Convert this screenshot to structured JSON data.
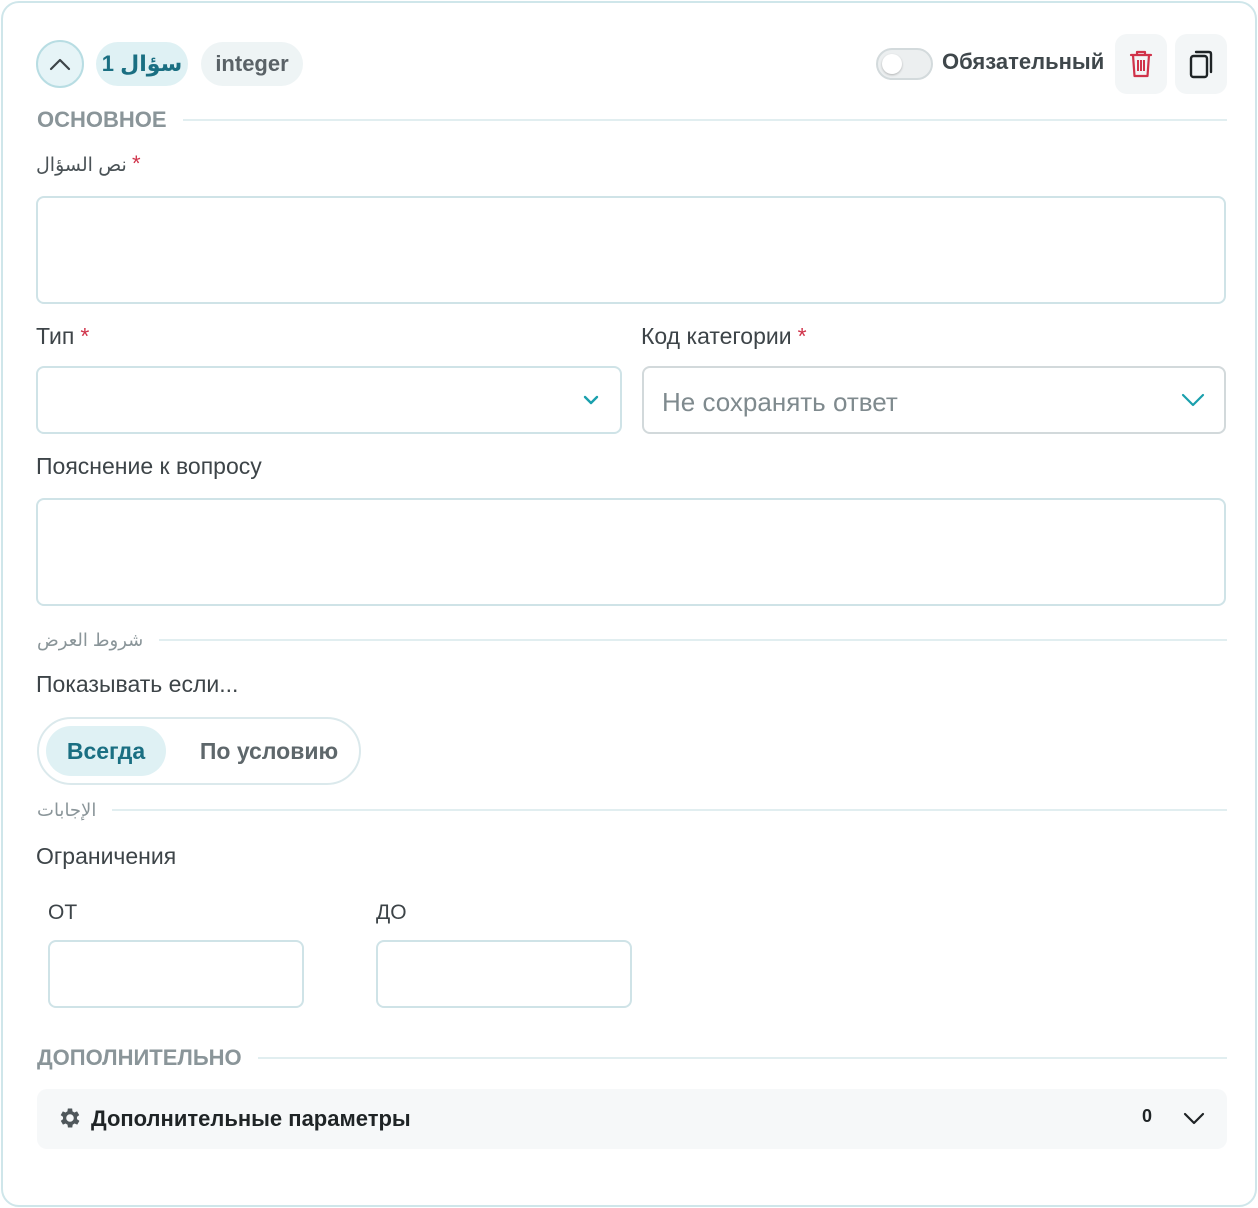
{
  "header": {
    "question_badge": "سؤال 1",
    "type_badge": "integer",
    "required_toggle": {
      "label": "Обязательный",
      "on": false
    },
    "colors": {
      "accent": "#1a6f82",
      "delete": "#d0334a"
    }
  },
  "sections": {
    "basic": "ОСНОВНОЕ",
    "display_conditions": "شروط العرض",
    "answers": "الإجابات",
    "additional": "ДОПОЛНИТЕЛЬНО"
  },
  "fields": {
    "question_text": {
      "label": "نص السؤال",
      "required": "*",
      "value": ""
    },
    "type": {
      "label": "Тип",
      "required": "*",
      "value": ""
    },
    "category_code": {
      "label": "Код категории",
      "required": "*",
      "value": "Не сохранять ответ"
    },
    "explanation": {
      "label": "Пояснение к вопросу",
      "value": ""
    }
  },
  "display": {
    "show_if_label": "Показывать если...",
    "options": [
      "Всегда",
      "По условию"
    ],
    "selected": "Всегда"
  },
  "limits": {
    "label": "Ограничения",
    "from_label": "ОТ",
    "to_label": "ДО",
    "from_value": "",
    "to_value": ""
  },
  "extra": {
    "label": "Дополнительные параметры",
    "count": "0"
  }
}
